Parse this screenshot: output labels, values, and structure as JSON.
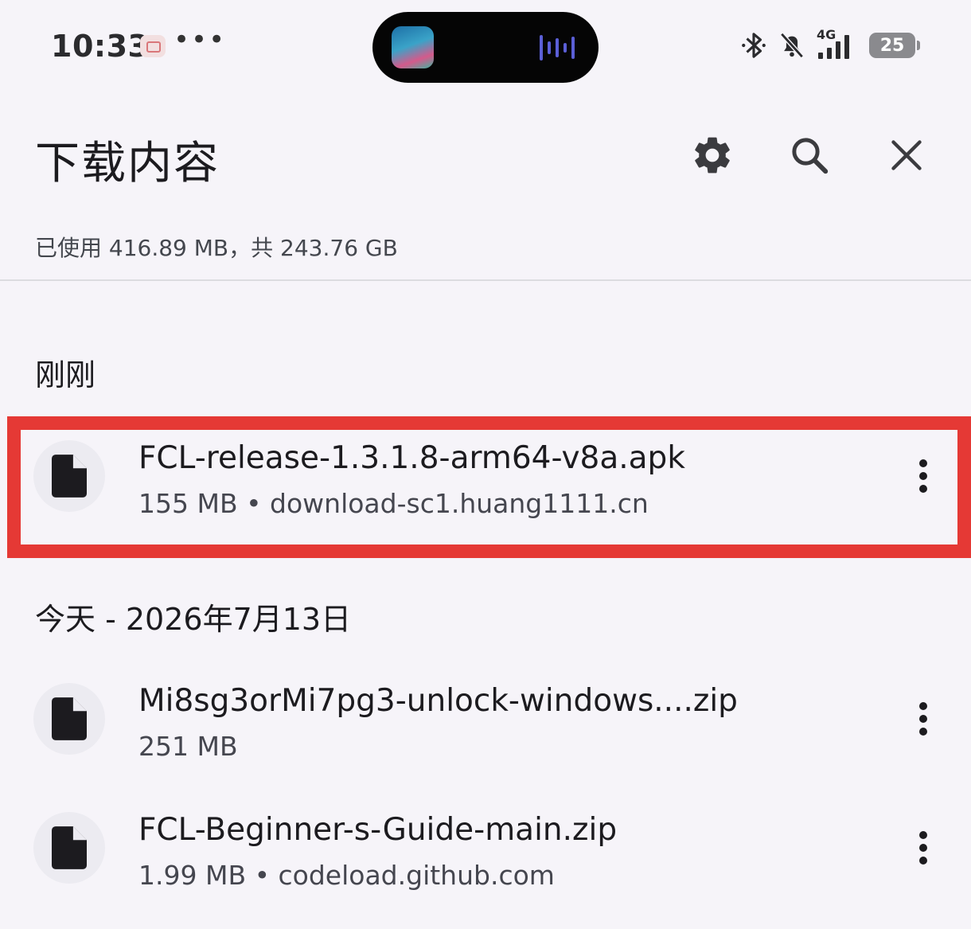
{
  "status_bar": {
    "time": "10:33",
    "network": "4G",
    "battery": "25"
  },
  "header": {
    "title": "下载内容",
    "settings_icon": "gear-icon",
    "search_icon": "search-icon",
    "close_icon": "close-icon"
  },
  "storage": {
    "text": "已使用 416.89 MB，共 243.76 GB"
  },
  "sections": [
    {
      "label": "刚刚",
      "items": [
        {
          "name": "FCL-release-1.3.1.8-arm64-v8a.apk",
          "meta": "155 MB • download-sc1.huang1111.cn"
        }
      ]
    },
    {
      "label": "今天 - 2026年7月13日",
      "items": [
        {
          "name": "Mi8sg3orMi7pg3-unlock-windows....zip",
          "meta": "251 MB"
        },
        {
          "name": "FCL-Beginner-s-Guide-main.zip",
          "meta": "1.99 MB • codeload.github.com"
        }
      ]
    }
  ],
  "colors": {
    "background": "#f6f4f9",
    "highlight": "#e53935",
    "icon_circle": "#ecebf1"
  }
}
